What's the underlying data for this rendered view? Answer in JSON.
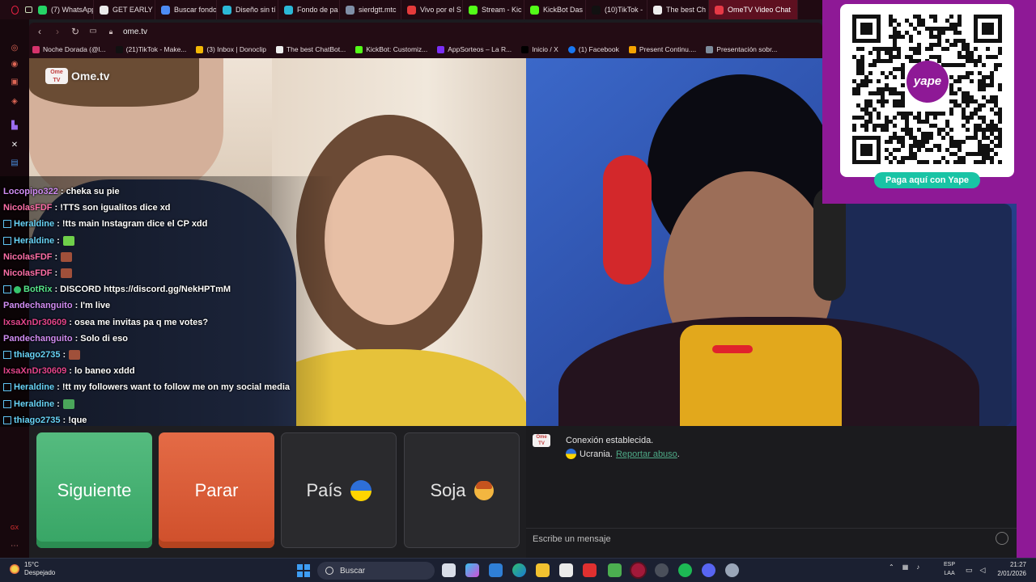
{
  "browser": {
    "tabs": [
      {
        "label": "(7) WhatsApp",
        "color": "#25d366"
      },
      {
        "label": "GET EARLY",
        "color": "#eaeaea"
      },
      {
        "label": "Buscar fondo",
        "color": "#4d8cf5"
      },
      {
        "label": "Diseño sin tí",
        "color": "#2bb8d6"
      },
      {
        "label": "Fondo de pa",
        "color": "#2bb8d6"
      },
      {
        "label": "sierdgtt.mtc",
        "color": "#7f8fa6"
      },
      {
        "label": "Vivo por el S",
        "color": "#e43b3b"
      },
      {
        "label": "Stream - Kic",
        "color": "#53fc18"
      },
      {
        "label": "KickBot Das",
        "color": "#53fc18"
      },
      {
        "label": "(10)TikTok -",
        "color": "#111111"
      },
      {
        "label": "The best Ch",
        "color": "#eeeeee"
      },
      {
        "label": "OmeTV Video Chat",
        "color": "#e63946"
      }
    ],
    "url": "ome.tv",
    "bookmarks": [
      {
        "label": "Noche Dorada (@l...",
        "color": "#d6336c"
      },
      {
        "label": "(21)TikTok - Make...",
        "color": "#111111"
      },
      {
        "label": "(3) Inbox | Donoclip",
        "color": "#f2b705"
      },
      {
        "label": "The best ChatBot...",
        "color": "#eeeeee"
      },
      {
        "label": "KickBot: Customiz...",
        "color": "#53fc18"
      },
      {
        "label": "AppSorteos – La R...",
        "color": "#7b2ff7"
      },
      {
        "label": "Inicio / X",
        "color": "#000000"
      },
      {
        "label": "(1) Facebook",
        "color": "#1877f2"
      },
      {
        "label": "Present Continu....",
        "color": "#f4a300"
      },
      {
        "label": "Presentación sobr...",
        "color": "#7d8c9c"
      }
    ]
  },
  "overlay": {
    "logo_box": "Ome\nTV",
    "logo_text": "Ome.tv"
  },
  "chat": [
    {
      "user": "Locopipo322",
      "color": "#d08cf2",
      "msg": ": cheka su pie",
      "badge": ""
    },
    {
      "user": "NicolasFDF",
      "color": "#ff6fa8",
      "msg": ": !TTS son igualitos dice xd",
      "badge": ""
    },
    {
      "user": "Heraldine",
      "color": "#68d3f7",
      "msg": ": !tts main Instagram dice el CP xdd",
      "badge": "sub"
    },
    {
      "user": "Heraldine",
      "color": "#68d3f7",
      "msg": ":",
      "badge": "sub",
      "emote": "#6fd04a"
    },
    {
      "user": "NicolasFDF",
      "color": "#ff6fa8",
      "msg": ":",
      "badge": "",
      "emote": "#a0503a"
    },
    {
      "user": "NicolasFDF",
      "color": "#ff6fa8",
      "msg": ":",
      "badge": "",
      "emote": "#a0503a"
    },
    {
      "user": "BotRix",
      "color": "#56e38a",
      "msg": ": DISCORD https://discord.gg/NekHPTmM",
      "badge": "bot"
    },
    {
      "user": "Pandechanguito",
      "color": "#d08cf2",
      "msg": ": I'm live",
      "badge": ""
    },
    {
      "user": "IxsaXnDr30609",
      "color": "#e3458b",
      "msg": ": osea me invitas pa q me votes?",
      "badge": ""
    },
    {
      "user": "Pandechanguito",
      "color": "#d08cf2",
      "msg": ": Solo di eso",
      "badge": ""
    },
    {
      "user": "thiago2735",
      "color": "#68d3f7",
      "msg": ":",
      "badge": "sub",
      "emote": "#a0503a"
    },
    {
      "user": "IxsaXnDr30609",
      "color": "#e3458b",
      "msg": ": lo baneo xddd",
      "badge": ""
    },
    {
      "user": "Heraldine",
      "color": "#68d3f7",
      "msg": ": !tt my followers want to follow me on my social media",
      "badge": "sub"
    },
    {
      "user": "Heraldine",
      "color": "#68d3f7",
      "msg": ":",
      "badge": "sub",
      "emote": "#4aa65a"
    },
    {
      "user": "thiago2735",
      "color": "#68d3f7",
      "msg": ": !que",
      "badge": "sub"
    }
  ],
  "qr": {
    "brand": "yape",
    "button_label": "Paga aquí con Yape"
  },
  "controls": {
    "next_label": "Siguiente",
    "stop_label": "Parar",
    "country_label": "País",
    "gender_label": "Soja"
  },
  "messages": {
    "logo": "Ome\nTV",
    "connected": "Conexión establecida.",
    "country": "Ucrania.",
    "report": "Reportar abuso",
    "report_suffix": ".",
    "input_placeholder": "Escribe un mensaje"
  },
  "taskbar": {
    "temperature": "15°C",
    "weather": "Despejado",
    "search_label": "Buscar",
    "lang_top": "ESP",
    "lang_bottom": "LAA",
    "time": "21:27",
    "date": "2/01/2026"
  }
}
